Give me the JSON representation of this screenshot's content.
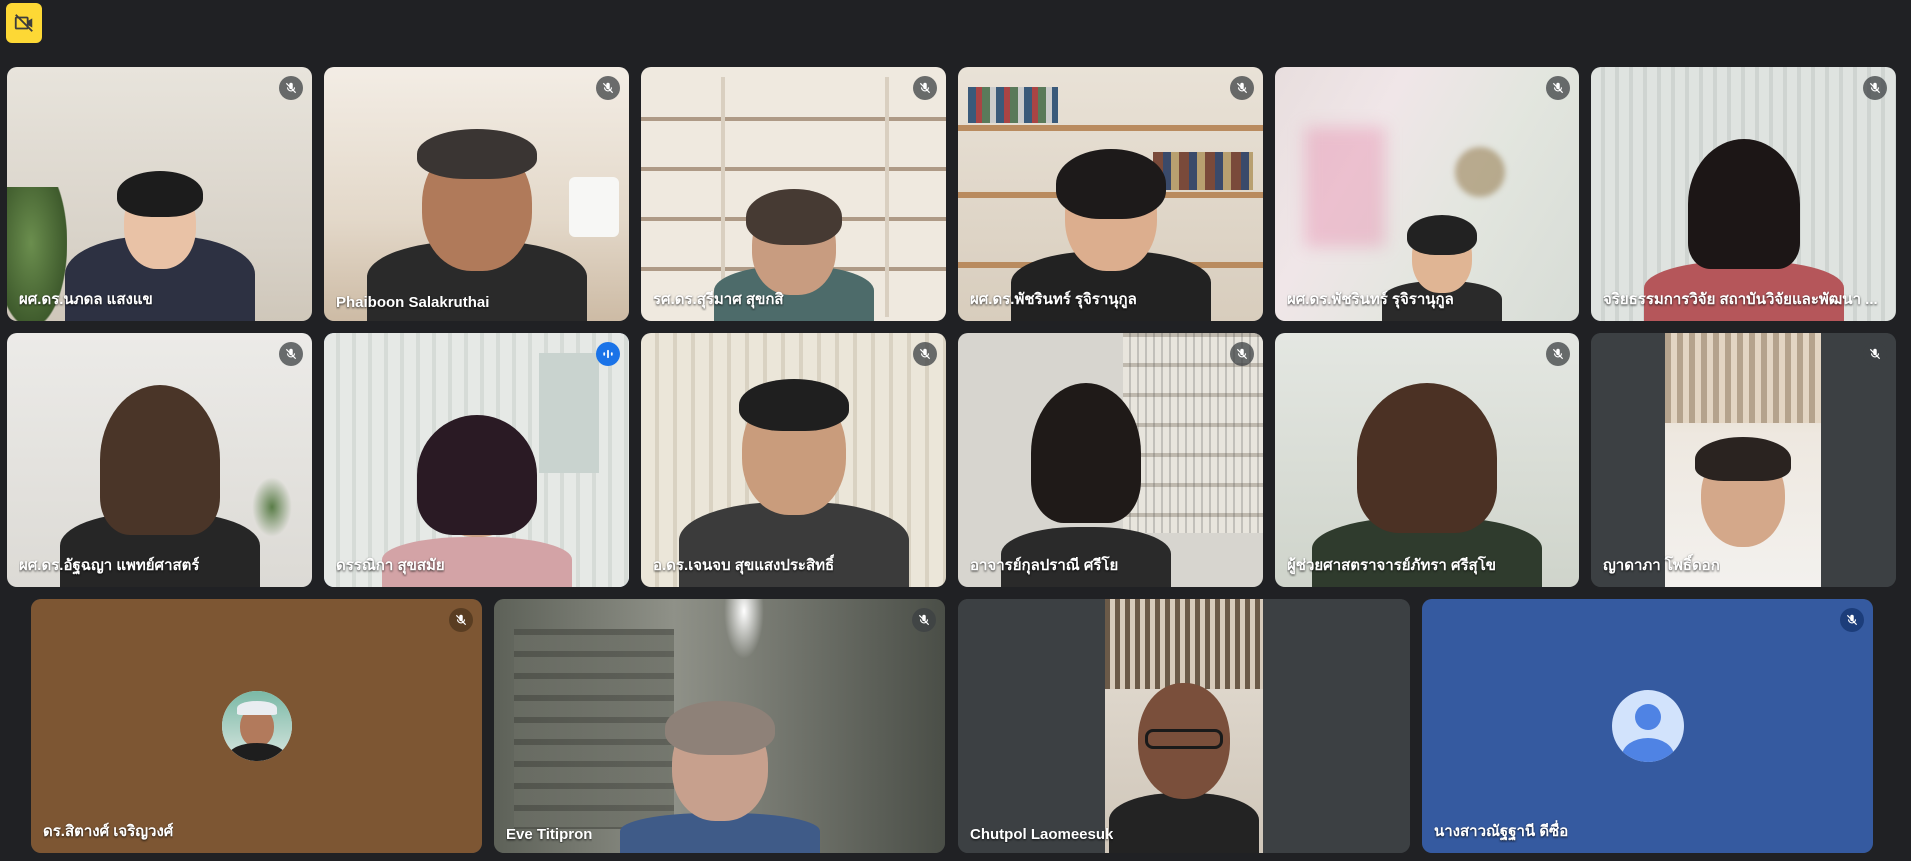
{
  "meeting": {
    "corner_badge_icon": "camera-off-icon",
    "accent": "#fdd835",
    "speaking_color": "#1a73e8",
    "tiles": [
      {
        "name": "ผศ.ดร.นภดล แสงแข",
        "muted": true
      },
      {
        "name": "Phaiboon Salakruthai",
        "muted": true
      },
      {
        "name": "รศ.ดร.สุรีมาศ สุขกสิ",
        "muted": true
      },
      {
        "name": "ผศ.ดร.พัชรินทร์ รุจิรานุกูล",
        "muted": true
      },
      {
        "name": "ผศ.ดร.พัชรินทร์ รุจิรานุกูล",
        "muted": true
      },
      {
        "name": "จริยธรรมการวิจัย สถาบันวิจัยและพัฒนา ...",
        "muted": true
      },
      {
        "name": "ผศ.ดร.อัฐฉญา แพทย์ศาสตร์",
        "muted": true
      },
      {
        "name": "ดรรณิกา สุขสมัย",
        "muted": false,
        "speaking": true
      },
      {
        "name": "อ.ดร.เจนจบ สุขแสงประสิทธิ์",
        "muted": true
      },
      {
        "name": "อาจารย์กุลปราณี ศรีโย",
        "muted": true
      },
      {
        "name": "ผู้ช่วยศาสตราจารย์ภัทรา ศรีสุโข",
        "muted": true
      },
      {
        "name": "ญาดาภา โพธิ์ดอก",
        "muted": true
      },
      {
        "name": "ดร.สิตางศ์ เจริญวงศ์",
        "muted": true
      },
      {
        "name": "Eve Titipron",
        "muted": true
      },
      {
        "name": "Chutpol Laomeesuk",
        "muted": false
      },
      {
        "name": "นางสาวณัฐฐานี ดีซื่อ",
        "muted": true
      }
    ]
  }
}
